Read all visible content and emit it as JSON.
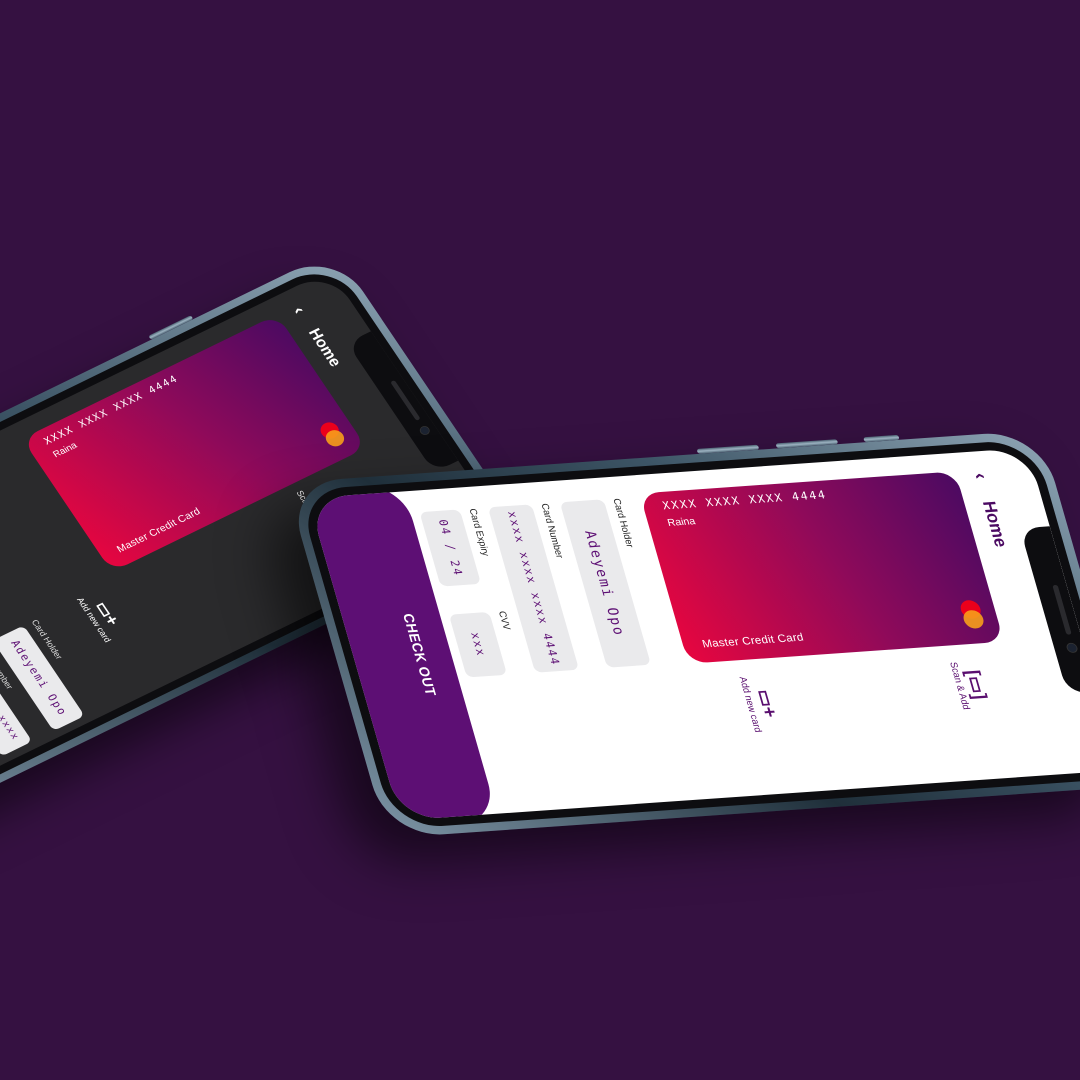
{
  "colors": {
    "background": "#351141",
    "accent": "#5d0f74",
    "card_gradient_start": "#4b0a62",
    "card_gradient_end": "#e8063f",
    "dark_screen": "#2a2a2c",
    "light_screen": "#ffffff",
    "field_light": "#eaeaec"
  },
  "header": {
    "title": "Home",
    "back_icon": "chevron-left-icon"
  },
  "card": {
    "type": "Master Credit Card",
    "holder": "Raina",
    "number": "XXXX XXXX XXXX 4444",
    "brand_icon": "mastercard-logo-icon"
  },
  "actions": {
    "add_card": {
      "label": "Add new card",
      "icon": "add-card-icon"
    },
    "scan_add": {
      "label": "Scan & Add",
      "icon": "scan-icon"
    }
  },
  "form": {
    "card_holder": {
      "label": "Card Holder",
      "value": "Adeyemi Opo"
    },
    "card_number": {
      "label": "Card Number",
      "value": "xxxx xxxx xxxx 4444"
    },
    "card_expiry": {
      "label": "Card Expiry",
      "value": "04 / 24"
    },
    "cvv": {
      "label": "CVV",
      "value": "xxx"
    }
  },
  "checkout": {
    "label": "CHECK OUT"
  }
}
